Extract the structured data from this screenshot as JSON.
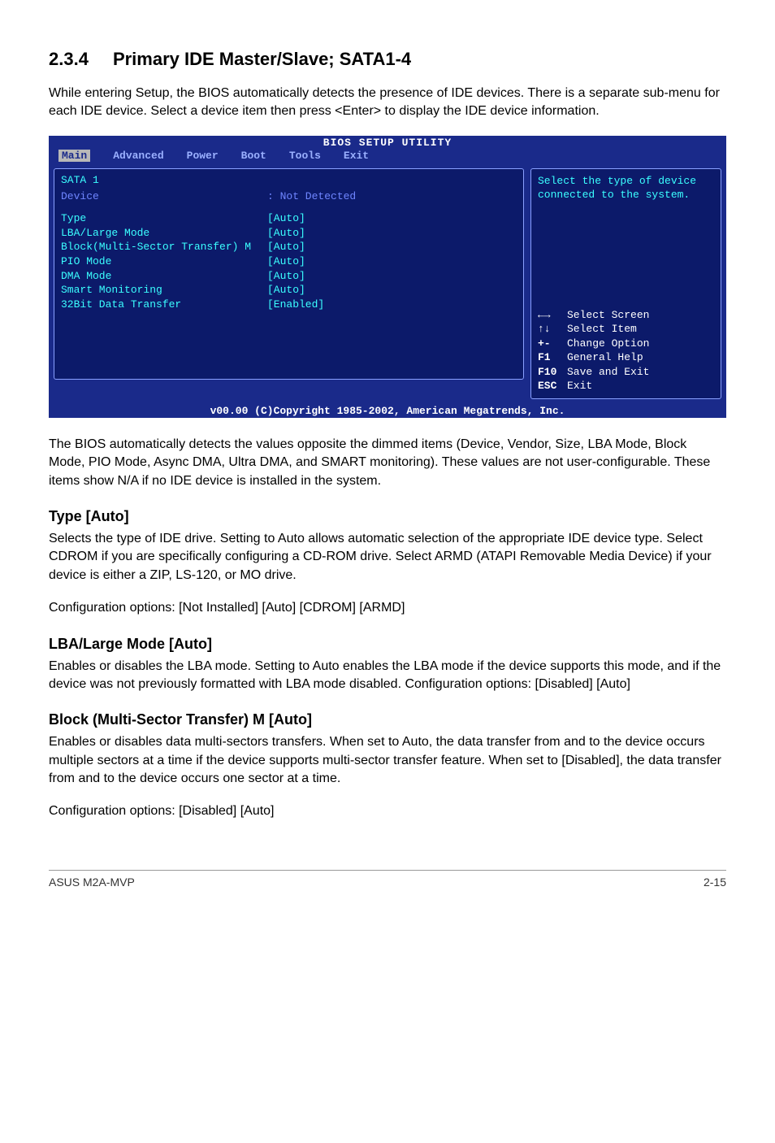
{
  "section": {
    "number": "2.3.4",
    "title": "Primary IDE Master/Slave; SATA1-4"
  },
  "intro": "While entering Setup, the BIOS automatically detects the presence of IDE devices. There is a separate sub-menu for each IDE device. Select a device item then press <Enter> to display the IDE device information.",
  "bios": {
    "title_bar": "BIOS SETUP UTILITY",
    "menu": [
      "Main",
      "Advanced",
      "Power",
      "Boot",
      "Tools",
      "Exit"
    ],
    "menu_active": "Main",
    "panel_title": "SATA 1",
    "device_label": "Device",
    "device_value": ": Not Detected",
    "fields": [
      {
        "label": "Type",
        "value": "[Auto]"
      },
      {
        "label": "LBA/Large Mode",
        "value": "[Auto]"
      },
      {
        "label": "Block(Multi-Sector Transfer) M",
        "value": "[Auto]"
      },
      {
        "label": "PIO Mode",
        "value": "[Auto]"
      },
      {
        "label": "DMA Mode",
        "value": "[Auto]"
      },
      {
        "label": "Smart Monitoring",
        "value": "[Auto]"
      },
      {
        "label": "32Bit Data Transfer",
        "value": "[Enabled]"
      }
    ],
    "help_top": "Select the type of device connected to the system.",
    "help_keys": [
      {
        "key": "←→",
        "desc": "Select Screen"
      },
      {
        "key": "↑↓",
        "desc": "Select Item"
      },
      {
        "key": "+-",
        "desc": "Change Option"
      },
      {
        "key": "F1",
        "desc": "General Help"
      },
      {
        "key": "F10",
        "desc": "Save and Exit"
      },
      {
        "key": "ESC",
        "desc": "Exit"
      }
    ],
    "footer": "v00.00 (C)Copyright 1985-2002, American Megatrends, Inc."
  },
  "after_bios": "The BIOS automatically detects the values opposite the dimmed items (Device, Vendor, Size, LBA Mode, Block Mode, PIO Mode, Async DMA, Ultra DMA, and SMART monitoring). These values are not user-configurable. These items show N/A if no IDE device is installed in the system.",
  "type_section": {
    "heading": "Type [Auto]",
    "body": "Selects the type of IDE drive. Setting to Auto allows automatic selection of the appropriate IDE device type. Select CDROM if you are specifically configuring a CD-ROM drive. Select ARMD (ATAPI Removable Media Device) if your device is either a ZIP, LS-120, or MO drive.",
    "options": "Configuration options: [Not Installed] [Auto] [CDROM] [ARMD]"
  },
  "lba_section": {
    "heading": "LBA/Large Mode [Auto]",
    "body": "Enables or disables the LBA mode. Setting to Auto enables the LBA mode if the device supports this mode, and if the device was not previously formatted with LBA mode disabled. Configuration options: [Disabled] [Auto]"
  },
  "block_section": {
    "heading": "Block (Multi-Sector Transfer) M [Auto]",
    "body": "Enables or disables data multi-sectors transfers. When set to Auto, the data transfer from and to the device occurs multiple sectors at a time if the device supports multi-sector transfer feature. When set to [Disabled], the data transfer from and to the device occurs one sector at a time.",
    "options": "Configuration options: [Disabled] [Auto]"
  },
  "page_footer": {
    "left": "ASUS M2A-MVP",
    "right": "2-15"
  }
}
